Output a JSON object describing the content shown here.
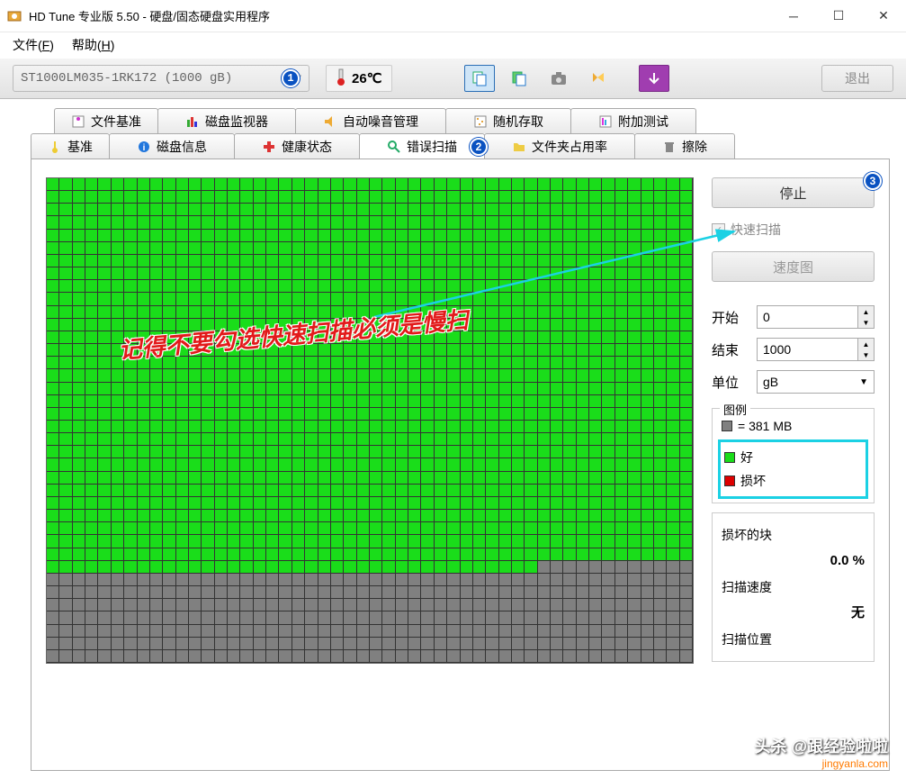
{
  "window": {
    "title": "HD Tune 专业版 5.50 - 硬盘/固态硬盘实用程序"
  },
  "menu": {
    "file": "文件(F)",
    "help": "帮助(H)"
  },
  "toolbar": {
    "drive": "ST1000LM035-1RK172 (1000 gB)",
    "temperature": "26℃",
    "exit": "退出"
  },
  "tabs": {
    "row1": [
      {
        "label": "文件基准"
      },
      {
        "label": "磁盘监视器"
      },
      {
        "label": "自动噪音管理"
      },
      {
        "label": "随机存取"
      },
      {
        "label": "附加测试"
      }
    ],
    "row2": [
      {
        "label": "基准"
      },
      {
        "label": "磁盘信息"
      },
      {
        "label": "健康状态"
      },
      {
        "label": "错误扫描",
        "active": true
      },
      {
        "label": "文件夹占用率"
      },
      {
        "label": "擦除"
      }
    ]
  },
  "scan": {
    "stop": "停止",
    "quick_scan": "快速扫描",
    "speed_map": "速度图",
    "start_label": "开始",
    "start_value": "0",
    "end_label": "结束",
    "end_value": "1000",
    "unit_label": "单位",
    "unit_value": "gB",
    "legend_title": "图例",
    "legend_size": "= 381 MB",
    "legend_ok": "好",
    "legend_bad": "损坏",
    "damaged_label": "损坏的块",
    "damaged_value": "0.0 %",
    "speed_label": "扫描速度",
    "speed_value": "无",
    "position_label": "扫描位置"
  },
  "annotation": {
    "text": "记得不要勾选快速扫描必须是慢扫"
  },
  "badges": {
    "b1": "1",
    "b2": "2",
    "b3": "3"
  },
  "watermark": {
    "text": "头杀 @跟经验啦啦",
    "url": "jingyanla.com"
  },
  "grid_progress": {
    "total_cols": 50,
    "total_rows": 38,
    "scanned_rows_full": 30,
    "partial_row_cols": 38
  }
}
